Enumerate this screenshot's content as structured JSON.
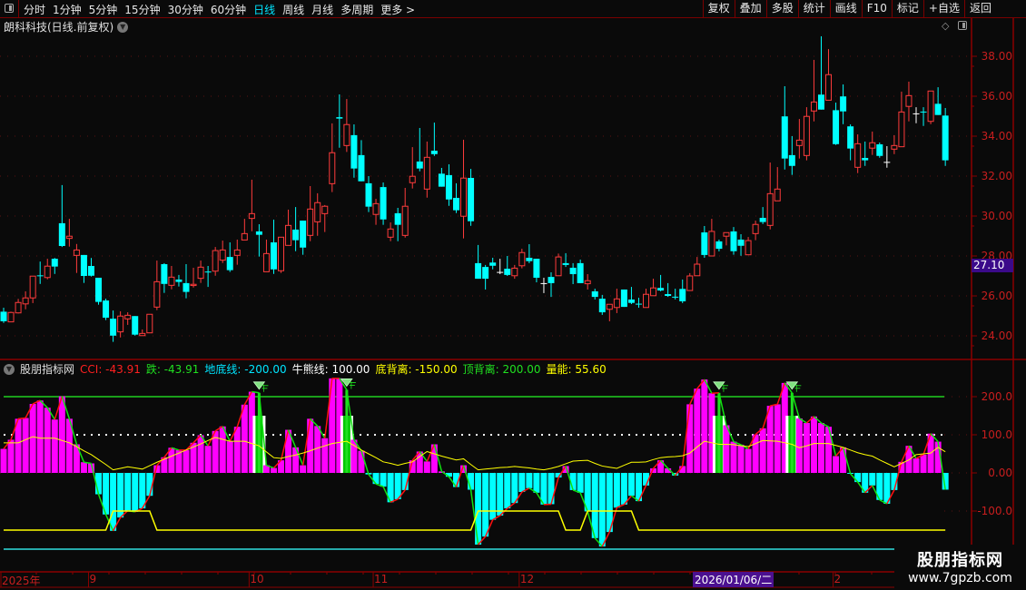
{
  "topbar": {
    "periods": [
      "分时",
      "1分钟",
      "5分钟",
      "15分钟",
      "30分钟",
      "60分钟",
      "日线",
      "周线",
      "月线",
      "多周期",
      "更多 >"
    ],
    "active_period": "日线",
    "tools": [
      "复权",
      "叠加",
      "多股",
      "统计",
      "画线",
      "F10",
      "标记",
      "+自选",
      "返回"
    ]
  },
  "stock": {
    "title": "朗科科技(日线.前复权)"
  },
  "crosshair": {
    "price": "27.10",
    "date": "2026/01/06/二"
  },
  "price_axis": {
    "labels": [
      "38.00",
      "36.00",
      "34.00",
      "32.00",
      "30.00",
      "28.00",
      "26.00",
      "24.00"
    ]
  },
  "indicator": {
    "name": "股朋指标网",
    "items": [
      {
        "label": "CCI: -43.91",
        "color": "#ff2020"
      },
      {
        "label": "跌: -43.91",
        "color": "#20e020"
      },
      {
        "label": "地底线: -200.00",
        "color": "#00e5ff"
      },
      {
        "label": "牛熊线: 100.00",
        "color": "#ffffff"
      },
      {
        "label": "底背离: -150.00",
        "color": "#ffff00"
      },
      {
        "label": "顶背离: 200.00",
        "color": "#20e020"
      },
      {
        "label": "量能: 55.60",
        "color": "#ffff00"
      }
    ],
    "axis_labels": [
      "200.0",
      "100.0",
      "0.00",
      "-100.0"
    ]
  },
  "date_axis": [
    {
      "label": "2025年",
      "at": 0
    },
    {
      "label": "9",
      "at": 12
    },
    {
      "label": "10",
      "at": 34
    },
    {
      "label": "11",
      "at": 51
    },
    {
      "label": "12",
      "at": 71
    },
    {
      "label": "2",
      "at": 114
    }
  ],
  "watermark": {
    "line1": "股朋指标网",
    "line2": "www.7gpzb.com"
  },
  "colors": {
    "up": "#ff3c3c",
    "down": "#00ffff",
    "doji": "#ffffff",
    "cci_pos": "#ff00ff",
    "cci_neg": "#00ffff",
    "signal": "#ffffff",
    "axis": "#c81e1e"
  },
  "chart_data": [
    {
      "type": "candlestick",
      "ylim": [
        23.5,
        39.5
      ],
      "grid": true,
      "ohlc": [
        [
          25.21,
          25.41,
          24.65,
          24.73
        ],
        [
          24.7,
          25.21,
          24.7,
          25.17
        ],
        [
          25.15,
          25.85,
          25.12,
          25.67
        ],
        [
          25.6,
          26.23,
          25.33,
          25.9
        ],
        [
          25.9,
          27.0,
          25.64,
          26.99
        ],
        [
          27.03,
          27.72,
          26.6,
          26.99
        ],
        [
          26.92,
          27.86,
          26.83,
          27.49
        ],
        [
          27.86,
          27.9,
          27.1,
          27.47
        ],
        [
          29.64,
          31.55,
          28.45,
          28.5
        ],
        [
          28.88,
          29.86,
          28.47,
          28.99
        ],
        [
          28.03,
          28.6,
          27.15,
          28.3
        ],
        [
          28.05,
          28.05,
          26.65,
          27.0
        ],
        [
          27.5,
          27.9,
          26.97,
          27.01
        ],
        [
          26.91,
          26.91,
          25.56,
          25.7
        ],
        [
          25.77,
          25.86,
          24.79,
          24.91
        ],
        [
          24.86,
          25.27,
          23.7,
          24.01
        ],
        [
          24.2,
          25.23,
          23.92,
          24.99
        ],
        [
          24.85,
          25.18,
          24.55,
          25.03
        ],
        [
          24.99,
          24.99,
          24.01,
          24.06
        ],
        [
          24.01,
          24.32,
          24.01,
          24.12
        ],
        [
          24.15,
          25.08,
          24.15,
          25.08
        ],
        [
          25.44,
          27.77,
          25.29,
          26.71
        ],
        [
          27.59,
          27.64,
          26.15,
          26.6
        ],
        [
          26.53,
          27.5,
          26.33,
          26.94
        ],
        [
          26.82,
          27.05,
          26.47,
          26.7
        ],
        [
          26.64,
          27.59,
          25.88,
          26.2
        ],
        [
          26.52,
          27.41,
          26.42,
          26.58
        ],
        [
          26.88,
          27.77,
          26.65,
          27.44
        ],
        [
          27.22,
          27.5,
          26.45,
          27.18
        ],
        [
          27.24,
          28.45,
          27.01,
          28.27
        ],
        [
          27.79,
          28.77,
          27.65,
          28.3
        ],
        [
          27.95,
          28.68,
          27.2,
          27.29
        ],
        [
          28.03,
          28.82,
          27.56,
          28.3
        ],
        [
          28.8,
          29.86,
          28.8,
          29.12
        ],
        [
          29.88,
          31.82,
          29.24,
          30.12
        ],
        [
          29.23,
          29.59,
          27.97,
          29.06
        ],
        [
          27.21,
          28.82,
          27.21,
          28.12
        ],
        [
          28.68,
          29.82,
          27.1,
          27.33
        ],
        [
          27.26,
          28.94,
          27.15,
          28.94
        ],
        [
          28.53,
          30.32,
          28.53,
          29.53
        ],
        [
          29.32,
          30.45,
          28.24,
          28.79
        ],
        [
          29.77,
          29.77,
          28.06,
          28.42
        ],
        [
          29.03,
          31.5,
          28.74,
          30.35
        ],
        [
          29.71,
          31.14,
          29.01,
          30.67
        ],
        [
          30.12,
          30.55,
          29.2,
          30.49
        ],
        [
          31.62,
          34.64,
          31.2,
          33.17
        ],
        [
          34.95,
          36.09,
          33.42,
          34.88
        ],
        [
          33.53,
          35.86,
          33.21,
          34.58
        ],
        [
          34.05,
          34.59,
          31.92,
          32.38
        ],
        [
          33.05,
          33.8,
          31.74,
          31.74
        ],
        [
          31.64,
          32.0,
          30.2,
          30.47
        ],
        [
          30.08,
          30.86,
          29.56,
          30.62
        ],
        [
          31.45,
          31.68,
          29.56,
          29.83
        ],
        [
          28.94,
          29.68,
          28.74,
          29.35
        ],
        [
          30.14,
          30.41,
          28.74,
          29.56
        ],
        [
          29.03,
          31.41,
          28.92,
          30.49
        ],
        [
          31.67,
          33.45,
          31.38,
          31.99
        ],
        [
          32.73,
          34.41,
          32.24,
          32.38
        ],
        [
          31.35,
          33.73,
          30.92,
          32.94
        ],
        [
          33.27,
          34.68,
          33.01,
          33.1
        ],
        [
          32.12,
          32.41,
          31.47,
          31.47
        ],
        [
          32.05,
          32.59,
          30.51,
          30.83
        ],
        [
          30.91,
          31.64,
          30.15,
          30.29
        ],
        [
          29.99,
          33.82,
          28.88,
          31.9
        ],
        [
          31.91,
          32.36,
          29.51,
          29.74
        ],
        [
          27.64,
          28.55,
          26.86,
          26.86
        ],
        [
          27.45,
          27.55,
          26.32,
          26.86
        ],
        [
          27.67,
          27.91,
          27.33,
          27.51
        ],
        [
          27.2,
          27.86,
          27.09,
          27.2
        ],
        [
          27.36,
          28.0,
          27.0,
          27.05
        ],
        [
          27.01,
          27.55,
          26.86,
          27.39
        ],
        [
          27.51,
          28.36,
          27.38,
          28.17
        ],
        [
          27.91,
          28.59,
          27.64,
          27.74
        ],
        [
          27.86,
          27.86,
          26.68,
          26.91
        ],
        [
          26.64,
          26.91,
          26.14,
          26.64
        ],
        [
          26.95,
          27.18,
          25.95,
          26.64
        ],
        [
          27.01,
          28.12,
          27.01,
          27.95
        ],
        [
          27.64,
          28.14,
          27.45,
          27.55
        ],
        [
          27.41,
          27.64,
          26.59,
          27.09
        ],
        [
          27.64,
          27.82,
          26.64,
          26.64
        ],
        [
          26.61,
          27.09,
          26.32,
          26.76
        ],
        [
          26.23,
          26.36,
          25.82,
          25.95
        ],
        [
          25.86,
          26.05,
          25.05,
          25.18
        ],
        [
          25.33,
          25.58,
          24.73,
          25.58
        ],
        [
          25.42,
          26.36,
          25.14,
          25.85
        ],
        [
          26.32,
          26.32,
          25.45,
          25.45
        ],
        [
          25.82,
          26.45,
          25.59,
          25.65
        ],
        [
          25.61,
          25.91,
          25.41,
          25.57
        ],
        [
          25.42,
          26.36,
          25.42,
          26.08
        ],
        [
          26.01,
          26.86,
          26.01,
          26.4
        ],
        [
          26.4,
          27.05,
          26.23,
          26.27
        ],
        [
          26.09,
          26.64,
          25.95,
          26.0
        ],
        [
          25.96,
          26.36,
          25.82,
          25.92
        ],
        [
          26.35,
          26.82,
          25.64,
          25.73
        ],
        [
          26.27,
          27.14,
          26.27,
          27.0
        ],
        [
          27.01,
          27.95,
          27.01,
          27.59
        ],
        [
          29.18,
          29.5,
          27.91,
          28.05
        ],
        [
          28.0,
          29.86,
          28.0,
          29.23
        ],
        [
          28.73,
          28.82,
          28.23,
          28.36
        ],
        [
          28.99,
          29.17,
          28.53,
          29.17
        ],
        [
          29.23,
          29.45,
          28.06,
          28.24
        ],
        [
          28.82,
          29.09,
          28.01,
          28.51
        ],
        [
          28.06,
          28.95,
          28.06,
          28.77
        ],
        [
          29.12,
          29.77,
          28.79,
          29.58
        ],
        [
          29.91,
          30.45,
          29.6,
          29.7
        ],
        [
          29.53,
          32.68,
          29.33,
          31.12
        ],
        [
          30.76,
          32.45,
          30.76,
          31.35
        ],
        [
          34.99,
          36.5,
          32.33,
          32.88
        ],
        [
          33.05,
          34.0,
          32.06,
          32.51
        ],
        [
          33.53,
          34.86,
          32.88,
          33.8
        ],
        [
          33.03,
          35.45,
          32.79,
          34.99
        ],
        [
          35.26,
          37.82,
          34.74,
          35.71
        ],
        [
          36.08,
          39.0,
          35.33,
          35.33
        ],
        [
          35.8,
          38.36,
          35.8,
          37.08
        ],
        [
          35.3,
          35.68,
          33.56,
          33.6
        ],
        [
          35.99,
          36.59,
          34.6,
          35.24
        ],
        [
          34.49,
          34.59,
          32.79,
          33.38
        ],
        [
          32.44,
          34.09,
          32.15,
          33.62
        ],
        [
          32.91,
          33.73,
          32.51,
          32.79
        ],
        [
          33.4,
          34.23,
          33.06,
          33.67
        ],
        [
          33.59,
          33.68,
          32.92,
          33.01
        ],
        [
          32.71,
          33.5,
          32.42,
          32.71
        ],
        [
          33.35,
          34.05,
          33.1,
          33.53
        ],
        [
          33.47,
          36.23,
          33.47,
          35.21
        ],
        [
          35.49,
          36.73,
          34.74,
          36.03
        ],
        [
          35.14,
          35.45,
          34.65,
          35.14
        ],
        [
          35.23,
          35.45,
          34.51,
          35.19
        ],
        [
          34.74,
          36.26,
          34.6,
          36.26
        ],
        [
          35.62,
          36.45,
          35.06,
          35.06
        ],
        [
          35.03,
          35.41,
          32.51,
          32.79
        ]
      ]
    },
    {
      "type": "bar+line",
      "ylim": [
        -260,
        293
      ],
      "reference_lines": {
        "顶背离": 200,
        "牛熊线": 100,
        "zero": 0,
        "地底线": -200
      },
      "cci": [
        63,
        87,
        142,
        144,
        181,
        190,
        171,
        140,
        201,
        142,
        75,
        28,
        25,
        -56,
        -109,
        -152,
        -117,
        -99,
        -102,
        -93,
        -60,
        20,
        41,
        66,
        60,
        60,
        79,
        99,
        71,
        110,
        122,
        83,
        121,
        179,
        213,
        210,
        20,
        13,
        33,
        113,
        67,
        20,
        142,
        123,
        91,
        248,
        248,
        218,
        87,
        58,
        -4,
        -29,
        -36,
        -77,
        -69,
        -45,
        33,
        56,
        30,
        75,
        4,
        -10,
        -37,
        20,
        -44,
        -188,
        -167,
        -123,
        -112,
        -93,
        -79,
        -50,
        -40,
        -52,
        -83,
        -82,
        -12,
        18,
        -45,
        -52,
        -101,
        -171,
        -193,
        -155,
        -91,
        -83,
        -60,
        -74,
        -33,
        12,
        33,
        12,
        -7,
        18,
        180,
        221,
        245,
        209,
        210,
        125,
        82,
        74,
        63,
        101,
        117,
        176,
        180,
        236,
        210,
        143,
        131,
        148,
        131,
        121,
        44,
        67,
        -2,
        -24,
        -52,
        -33,
        -71,
        -81,
        -45,
        29,
        71,
        38,
        48,
        103,
        82,
        -43.91
      ],
      "signals": [
        35,
        47,
        98,
        108
      ],
      "signal_level": 150,
      "volume_energy": [
        79,
        79,
        79,
        87,
        95,
        91,
        91,
        91,
        85,
        79,
        69,
        58,
        48,
        35,
        22,
        8,
        12,
        16,
        13,
        10,
        19,
        28,
        36,
        44,
        52,
        60,
        68,
        76,
        85,
        93,
        88,
        83,
        83,
        83,
        77,
        71,
        55,
        40,
        38,
        43,
        47,
        52,
        58,
        65,
        71,
        77,
        80,
        83,
        72,
        60,
        50,
        40,
        29,
        25,
        20,
        25,
        29,
        43,
        56,
        50,
        44,
        39,
        34,
        37,
        22,
        8,
        10,
        12,
        14,
        15,
        17,
        15,
        13,
        10,
        8,
        12,
        17,
        24,
        31,
        32,
        33,
        25,
        18,
        15,
        12,
        20,
        28,
        28,
        29,
        35,
        40,
        42,
        43,
        45,
        52,
        68,
        83,
        79,
        75,
        75,
        74,
        71,
        69,
        77,
        85,
        84,
        83,
        79,
        75,
        66,
        71,
        77,
        77,
        77,
        72,
        67,
        60,
        53,
        48,
        44,
        34,
        25,
        16,
        25,
        34,
        48,
        50,
        52,
        67,
        55.6
      ],
      "bottom_divergence": [
        -150,
        -150,
        -150,
        -150,
        -150,
        -150,
        -150,
        -150,
        -150,
        -150,
        -150,
        -150,
        -150,
        -150,
        -150,
        -100,
        -100,
        -100,
        -100,
        -100,
        -100,
        -150,
        -150,
        -150,
        -150,
        -150,
        -150,
        -150,
        -150,
        -150,
        -150,
        -150,
        -150,
        -150,
        -150,
        -150,
        -150,
        -150,
        -150,
        -150,
        -150,
        -150,
        -150,
        -150,
        -150,
        -150,
        -150,
        -150,
        -150,
        -150,
        -150,
        -150,
        -150,
        -150,
        -150,
        -150,
        -150,
        -150,
        -150,
        -150,
        -150,
        -150,
        -150,
        -150,
        -150,
        -100,
        -100,
        -100,
        -100,
        -100,
        -100,
        -100,
        -100,
        -100,
        -100,
        -100,
        -100,
        -150,
        -150,
        -150,
        -100,
        -100,
        -100,
        -100,
        -100,
        -100,
        -100,
        -150,
        -150,
        -150,
        -150,
        -150,
        -150,
        -150,
        -150,
        -150,
        -150,
        -150,
        -150,
        -150,
        -150,
        -150,
        -150,
        -150,
        -150,
        -150,
        -150,
        -150,
        -150,
        -150,
        -150,
        -150,
        -150,
        -150,
        -150,
        -150,
        -150,
        -150,
        -150,
        -150,
        -150,
        -150,
        -150,
        -150,
        -150,
        -150,
        -150,
        -150,
        -150,
        -150
      ]
    }
  ]
}
